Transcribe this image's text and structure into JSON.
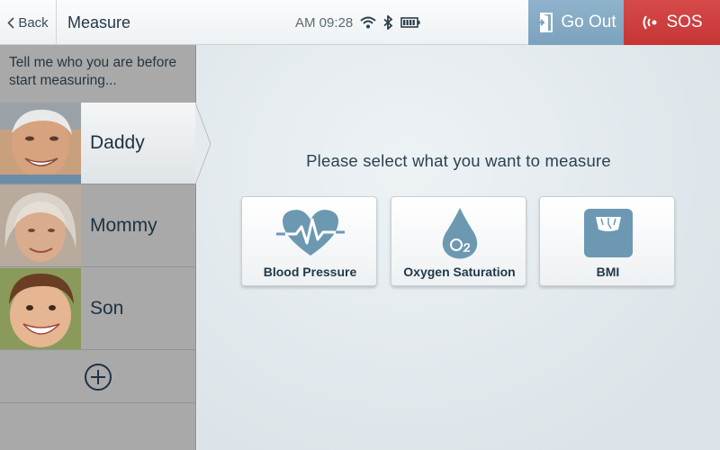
{
  "header": {
    "back_label": "Back",
    "title": "Measure",
    "time": "AM 09:28",
    "goout_label": "Go Out",
    "sos_label": "SOS"
  },
  "sidebar": {
    "prompt": "Tell me who you are before start measuring...",
    "profiles": [
      {
        "name": "Daddy",
        "selected": true
      },
      {
        "name": "Mommy",
        "selected": false
      },
      {
        "name": "Son",
        "selected": false
      }
    ]
  },
  "main": {
    "title": "Please select what you want to measure",
    "options": [
      {
        "label": "Blood Pressure",
        "icon": "heart-pulse-icon"
      },
      {
        "label": "Oxygen Saturation",
        "icon": "oxygen-drop-icon"
      },
      {
        "label": "BMI",
        "icon": "scale-icon"
      }
    ]
  },
  "colors": {
    "accent": "#6d98b2",
    "goout": "#84a9c3",
    "sos": "#cf3f3f"
  }
}
